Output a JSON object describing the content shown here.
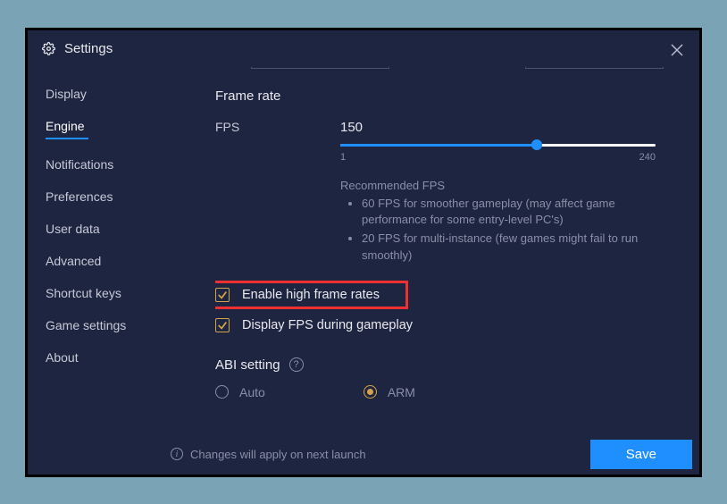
{
  "header": {
    "title": "Settings"
  },
  "sidebar": {
    "items": [
      {
        "label": "Display",
        "active": false
      },
      {
        "label": "Engine",
        "active": true
      },
      {
        "label": "Notifications",
        "active": false
      },
      {
        "label": "Preferences",
        "active": false
      },
      {
        "label": "User data",
        "active": false
      },
      {
        "label": "Advanced",
        "active": false
      },
      {
        "label": "Shortcut keys",
        "active": false
      },
      {
        "label": "Game settings",
        "active": false
      },
      {
        "label": "About",
        "active": false
      }
    ]
  },
  "main": {
    "frame_rate": {
      "title": "Frame rate",
      "fps_label": "FPS",
      "fps_value": "150",
      "slider_min": "1",
      "slider_max": "240",
      "recommended_title": "Recommended FPS",
      "recommended": [
        "60 FPS for smoother gameplay (may affect game performance for some entry-level PC's)",
        "20 FPS for multi-instance (few games might fail to run smoothly)"
      ],
      "checkbox1": "Enable high frame rates",
      "checkbox2": "Display FPS during gameplay"
    },
    "abi": {
      "title": "ABI setting",
      "options": [
        {
          "label": "Auto",
          "selected": false
        },
        {
          "label": "ARM",
          "selected": true
        }
      ]
    }
  },
  "footer": {
    "message": "Changes will apply on next launch",
    "save_label": "Save"
  }
}
